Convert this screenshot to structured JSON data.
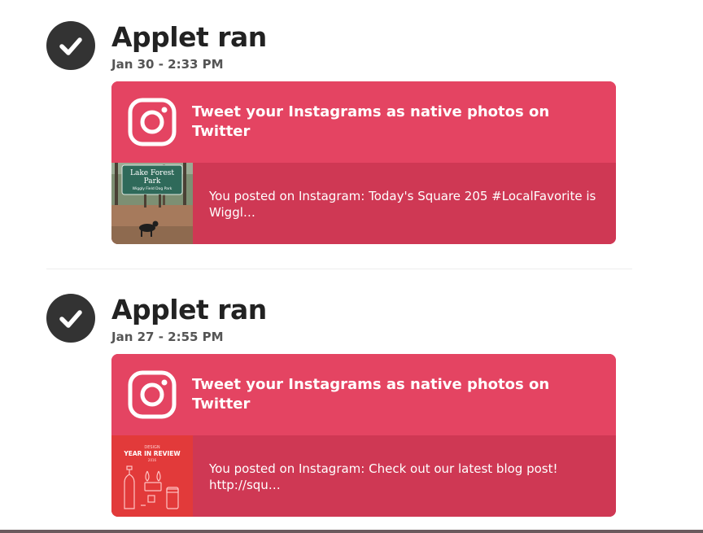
{
  "runs": [
    {
      "title": "Applet ran",
      "date": "Jan 30 - 2:33 PM",
      "applet_name": "Tweet your Instagrams as native photos on Twitter",
      "message": "You posted on Instagram: Today's Square 205 #LocalFavorite is Wiggl…",
      "thumbnail": {
        "sign_line1": "Lake Forest",
        "sign_line2": "Park",
        "sign_line3": "Wiggly Field Dog Park"
      }
    },
    {
      "title": "Applet ran",
      "date": "Jan 27 - 2:55 PM",
      "applet_name": "Tweet your Instagrams as native photos on Twitter",
      "message": "You posted on Instagram: Check out our latest blog post! http://squ…",
      "thumbnail": {
        "line1": "DESIGN",
        "line2": "YEAR IN REVIEW",
        "line3": "2016"
      }
    }
  ],
  "icons": {
    "status": "check-circle-icon",
    "service": "instagram-icon"
  },
  "colors": {
    "card_top": "#e44462",
    "card_bottom": "#cf3854",
    "check_bg": "#333333"
  }
}
